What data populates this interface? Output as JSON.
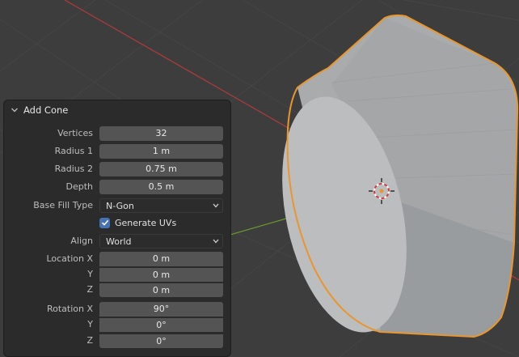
{
  "panel": {
    "title": "Add Cone",
    "vertices": {
      "label": "Vertices",
      "value": "32"
    },
    "radius1": {
      "label": "Radius 1",
      "value": "1 m"
    },
    "radius2": {
      "label": "Radius 2",
      "value": "0.75 m"
    },
    "depth": {
      "label": "Depth",
      "value": "0.5 m"
    },
    "base_fill": {
      "label": "Base Fill Type",
      "value": "N-Gon"
    },
    "generate_uvs": {
      "label": "Generate UVs",
      "checked": true
    },
    "align": {
      "label": "Align",
      "value": "World"
    },
    "location": {
      "label_x": "Location X",
      "label_y": "Y",
      "label_z": "Z",
      "x": "0 m",
      "y": "0 m",
      "z": "0 m"
    },
    "rotation": {
      "label_x": "Rotation X",
      "label_y": "Y",
      "label_z": "Z",
      "x": "90°",
      "y": "0°",
      "z": "0°"
    }
  },
  "colors": {
    "viewport_bg": "#3d3d3d",
    "panel_bg": "#2b2b2b",
    "field_bg": "#545454",
    "selection_outline": "#e8962d",
    "checkbox_accent": "#4772b3",
    "x_axis": "#b13a3a",
    "y_axis": "#6a9a2c"
  }
}
